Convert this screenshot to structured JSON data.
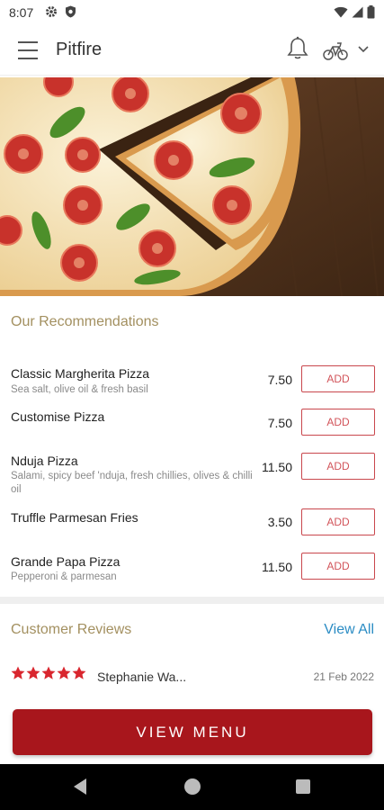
{
  "status_bar": {
    "time": "8:07"
  },
  "app_bar": {
    "title": "Pitfire"
  },
  "recommendations": {
    "title": "Our Recommendations",
    "add_label": "ADD",
    "items": [
      {
        "name": "Classic Margherita Pizza",
        "description": "Sea salt, olive oil & fresh basil",
        "price": "7.50"
      },
      {
        "name": "Customise Pizza",
        "description": "",
        "price": "7.50"
      },
      {
        "name": "Nduja Pizza",
        "description": "Salami, spicy beef 'nduja, fresh chillies, olives & chilli oil",
        "price": "11.50"
      },
      {
        "name": "Truffle Parmesan Fries",
        "description": "",
        "price": "3.50"
      },
      {
        "name": "Grande Papa Pizza",
        "description": "Pepperoni & parmesan",
        "price": "11.50"
      }
    ]
  },
  "reviews": {
    "title": "Customer Reviews",
    "view_all": "View All",
    "items": [
      {
        "rating": 5,
        "reviewer": "Stephanie Wa...",
        "date": "21 Feb 2022"
      }
    ]
  },
  "cta": {
    "label": "VIEW MENU"
  },
  "colors": {
    "accent": "#a8161c",
    "section_title": "#a39060",
    "link": "#2b8cc4",
    "star": "#d9262e"
  },
  "icons": [
    "menu-icon",
    "bell-icon",
    "bike-icon",
    "chevron-down-icon",
    "star-icon",
    "back-icon",
    "home-icon",
    "recents-icon"
  ]
}
